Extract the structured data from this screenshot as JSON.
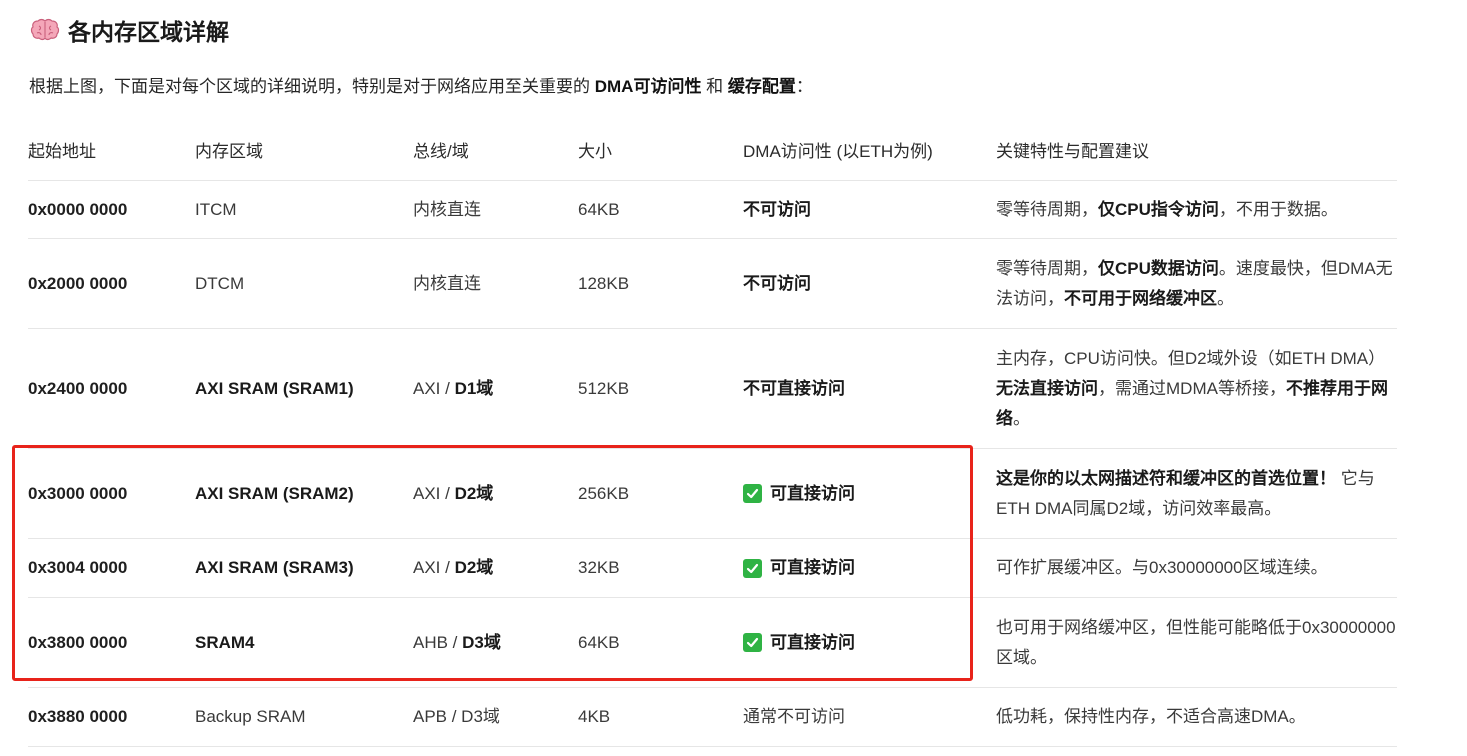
{
  "heading": {
    "icon": "brain-icon",
    "title": "各内存区域详解"
  },
  "intro": {
    "before": "根据上图，下面是对每个区域的详细说明，特别是对于网络应用至关重要的 ",
    "em1": "DMA可访问性",
    "mid": " 和 ",
    "em2": "缓存配置",
    "after": "："
  },
  "table": {
    "headers": [
      "起始地址",
      "内存区域",
      "总线/域",
      "大小",
      "DMA访问性 (以ETH为例)",
      "关键特性与配置建议"
    ],
    "rows": [
      {
        "address": "0x0000 0000",
        "region": "ITCM",
        "bus": "内核直连",
        "bus_domain": "",
        "size": "64KB",
        "dma": "不可访问",
        "notes": [
          "零等待周期，",
          "仅CPU指令访问",
          "，不用于数据。"
        ]
      },
      {
        "address": "0x2000 0000",
        "region": "DTCM",
        "bus": "内核直连",
        "bus_domain": "",
        "size": "128KB",
        "dma": "不可访问",
        "notes": [
          "零等待周期，",
          "仅CPU数据访问",
          "。速度最快，但DMA无法访问，",
          "不可用于网络缓冲区",
          "。"
        ]
      },
      {
        "address": "0x2400 0000",
        "region": "AXI SRAM (SRAM1)",
        "bus": "AXI / ",
        "bus_domain": "D1域",
        "size": "512KB",
        "dma": "不可直接访问",
        "notes": [
          "主内存，CPU访问快。但D2域外设（如ETH DMA）",
          "无法直接访问",
          "，需通过MDMA等桥接，",
          "不推荐用于网络",
          "。"
        ]
      },
      {
        "address": "0x3000 0000",
        "region": "AXI SRAM (SRAM2)",
        "bus": "AXI / ",
        "bus_domain": "D2域",
        "size": "256KB",
        "dma": "可直接访问",
        "notes": [
          "这是你的以太网描述符和缓冲区的首选位置！",
          " 它与ETH DMA同属D2域，访问效率最高。"
        ]
      },
      {
        "address": "0x3004 0000",
        "region": "AXI SRAM (SRAM3)",
        "bus": "AXI / ",
        "bus_domain": "D2域",
        "size": "32KB",
        "dma": "可直接访问",
        "notes": [
          "可作扩展缓冲区。与0x30000000区域连续。"
        ]
      },
      {
        "address": "0x3800 0000",
        "region": "SRAM4",
        "bus": "AHB / ",
        "bus_domain": "D3域",
        "size": "64KB",
        "dma": "可直接访问",
        "notes": [
          "也可用于网络缓冲区，但性能可能略低于0x30000000区域。"
        ]
      },
      {
        "address": "0x3880 0000",
        "region": "Backup SRAM",
        "bus": "APB / D3域",
        "bus_domain": "",
        "size": "4KB",
        "dma": "通常不可访问",
        "notes": [
          "低功耗，保持性内存，不适合高速DMA。"
        ]
      }
    ]
  },
  "colors": {
    "highlight_border": "#e8231a",
    "check_green": "#2fb344"
  }
}
